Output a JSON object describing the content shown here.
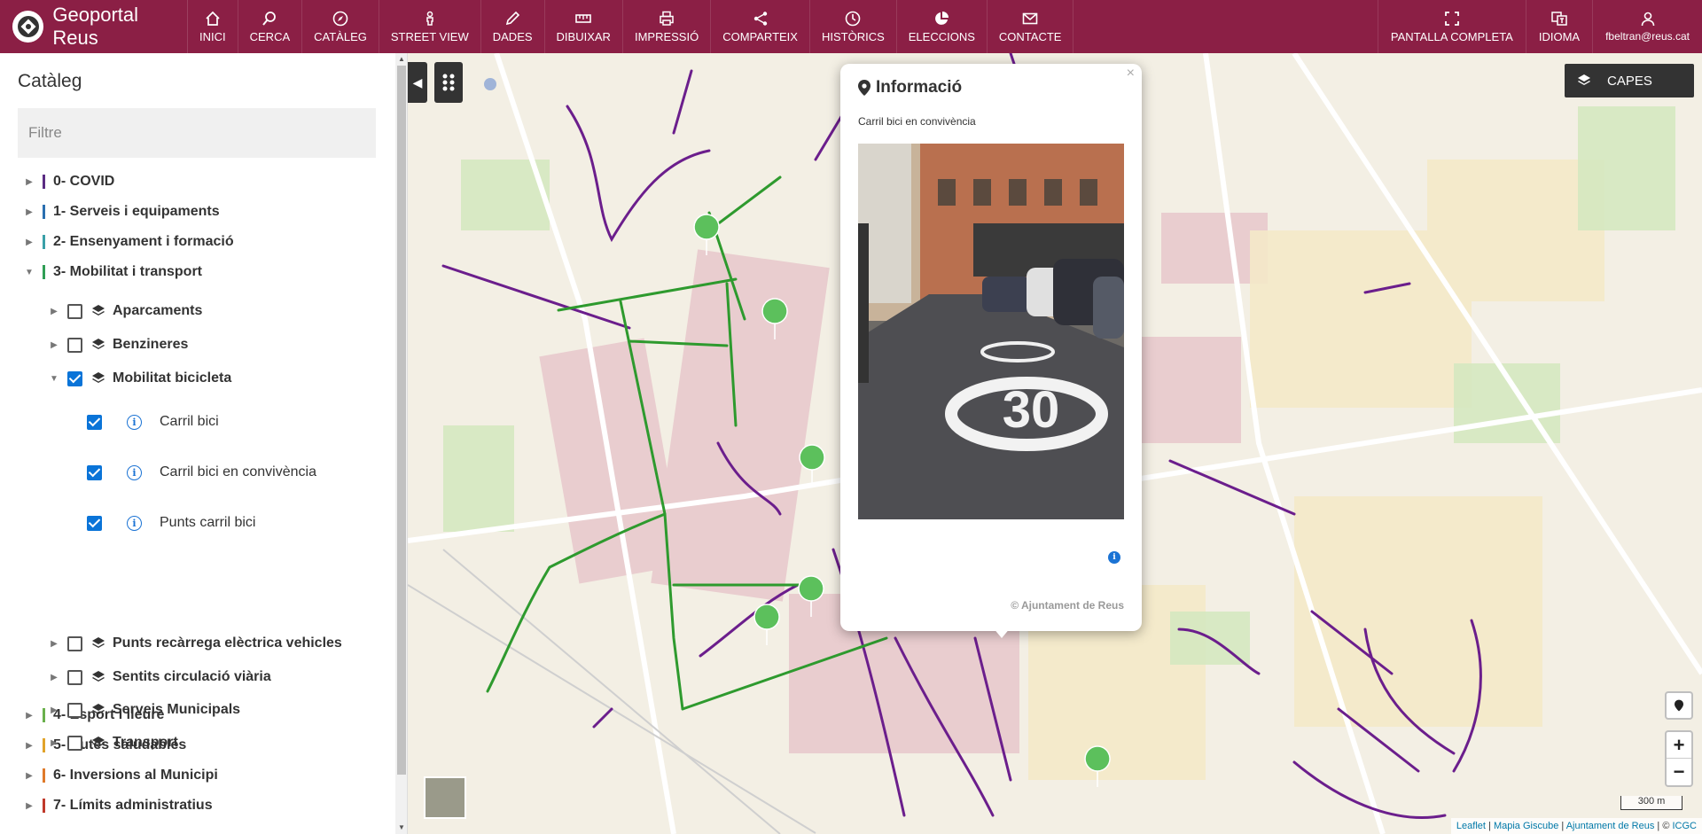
{
  "app": {
    "title": "Geoportal Reus",
    "brand_color": "#8b1f45"
  },
  "nav": [
    {
      "label": "INICI",
      "icon": "home-icon"
    },
    {
      "label": "CERCA",
      "icon": "search-icon"
    },
    {
      "label": "CATÀLEG",
      "icon": "compass-icon"
    },
    {
      "label": "STREET VIEW",
      "icon": "pegman-icon"
    },
    {
      "label": "DADES",
      "icon": "pencil-icon"
    },
    {
      "label": "DIBUIXAR",
      "icon": "ruler-icon"
    },
    {
      "label": "IMPRESSIÓ",
      "icon": "printer-icon"
    },
    {
      "label": "COMPARTEIX",
      "icon": "share-icon"
    },
    {
      "label": "HISTÒRICS",
      "icon": "clock-icon"
    },
    {
      "label": "ELECCIONS",
      "icon": "pie-chart-icon"
    },
    {
      "label": "CONTACTE",
      "icon": "mail-icon"
    }
  ],
  "nav_right": {
    "fullscreen": "PANTALLA COMPLETA",
    "language": "IDIOMA",
    "user": "fbeltran@reus.cat"
  },
  "sidebar": {
    "title": "Catàleg",
    "filter_placeholder": "Filtre",
    "categories": [
      {
        "label": "0- COVID",
        "color": "#5b2c83",
        "expanded": false
      },
      {
        "label": "1- Serveis i equipaments",
        "color": "#2a6fb0",
        "expanded": false
      },
      {
        "label": "2- Ensenyament i formació",
        "color": "#3aa0a8",
        "expanded": false
      },
      {
        "label": "3- Mobilitat i transport",
        "color": "#2f9e55",
        "expanded": true
      },
      {
        "label": "4- Esport i lleure",
        "color": "#6ab04c",
        "expanded": false
      },
      {
        "label": "5- Rutes saludables",
        "color": "#e1a32a",
        "expanded": false
      },
      {
        "label": "6- Inversions al Municipi",
        "color": "#e07a2a",
        "expanded": false
      },
      {
        "label": "7- Límits administratius",
        "color": "#c0392b",
        "expanded": false
      }
    ],
    "layers": [
      {
        "label": "Aparcaments",
        "checked": false
      },
      {
        "label": "Benzineres",
        "checked": false
      },
      {
        "label": "Mobilitat bicicleta",
        "checked": true
      },
      {
        "label": "Punts recàrrega elèctrica vehicles",
        "checked": false
      },
      {
        "label": "Sentits circulació viària",
        "checked": false
      },
      {
        "label": "Serveis Municipals",
        "checked": false
      },
      {
        "label": "Transport",
        "checked": false
      }
    ],
    "sublayers": [
      {
        "label": "Carril bici",
        "checked": true
      },
      {
        "label": "Carril bici en convivència",
        "checked": true
      },
      {
        "label": "Punts carril bici",
        "checked": true
      }
    ]
  },
  "map": {
    "capes_label": "CAPES",
    "popup": {
      "title": "Informació",
      "subtitle": "Carril bici en convivència",
      "credit": "© Ajuntament de Reus",
      "close": "×",
      "road_marking": "30"
    },
    "scale_label": "300 m",
    "attribution": {
      "leaflet": "Leaflet",
      "sep1": " | ",
      "giscube": "Mapia Giscube",
      "sep2": " | ",
      "ajuntament": "Ajuntament de Reus",
      "sep3": " | © ",
      "icgc": "ICGC"
    },
    "zoom_in": "+",
    "zoom_out": "−",
    "colors": {
      "bike_lane": "#6b1e8c",
      "shared_lane": "#2e9a2e",
      "marker": "#5cc05c"
    }
  }
}
